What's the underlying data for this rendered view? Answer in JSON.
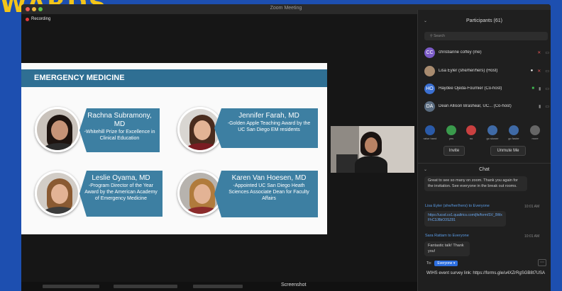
{
  "banner_text": "WARDS",
  "window": {
    "title": "Zoom Meeting",
    "recording_label": "Recording"
  },
  "slide": {
    "heading": "EMERGENCY MEDICINE",
    "cards": [
      {
        "name": "Rachna Subramony,",
        "name2": "MD",
        "desc": "-Whitehill Prize for Excellence in Clinical Education"
      },
      {
        "name": "Jennifer Farah, MD",
        "desc": "-Golden Apple Teaching Award by the UC San Diego EM residents"
      },
      {
        "name": "Leslie Oyama, MD",
        "desc": "-Program Director of the Year Award by the American Academy of Emergency Medicine"
      },
      {
        "name": "Karen Van Hoesen, MD",
        "desc": "-Appointed UC San Diego Heath Sciences Associate Dean for Faculty Affairs"
      }
    ]
  },
  "participants": {
    "header": "Participants (61)",
    "search_placeholder": "Search",
    "list": [
      {
        "initials": "CC",
        "name": "christianne coffey (me)",
        "color": "#7b5bc7"
      },
      {
        "initials": "",
        "name": "Lisa Eyler (she/her/hers) (Host)",
        "color": "#a88b6f"
      },
      {
        "initials": "HO",
        "name": "Haydee Ojeda-Fournier (Co-host)",
        "color": "#3a6fd1"
      },
      {
        "initials": "DA",
        "name": "Dean Allison Brashear, UC... (Co-host)",
        "color": "#5a6c80"
      }
    ],
    "reactions": [
      "raise hand",
      "yes",
      "no",
      "go slower",
      "go faster",
      "more"
    ],
    "invite_label": "Invite",
    "unmute_label": "Unmute Me"
  },
  "chat": {
    "header": "Chat",
    "messages": [
      {
        "text": "Great to see so many on zoom. Thank you again for the invitation. See everyone in the break out rooms."
      },
      {
        "sender": "Lisa Eyler (she/her/hers)  to  Everyone",
        "time": "10:01 AM",
        "text": "https://ucsd.co1.qualtrics.com/jfe/form/SV_9WxFhC3J8bO3SZ81"
      },
      {
        "sender": "Sara Rattam  to  Everyone",
        "time": "10:01 AM",
        "text": "Fantastic talk! Thank you!"
      }
    ],
    "to_label": "To:",
    "to_value": "Everyone",
    "compose_text": "WIHS event survey link: https://forms.gle/u4XZrRgSGB8t7USA"
  },
  "taskbar": {
    "screenshot_label": "Screenshot"
  },
  "colors": {
    "accent": "#2f6f93",
    "zoom_blue": "#2d6fe0",
    "record": "#e03b3b"
  }
}
